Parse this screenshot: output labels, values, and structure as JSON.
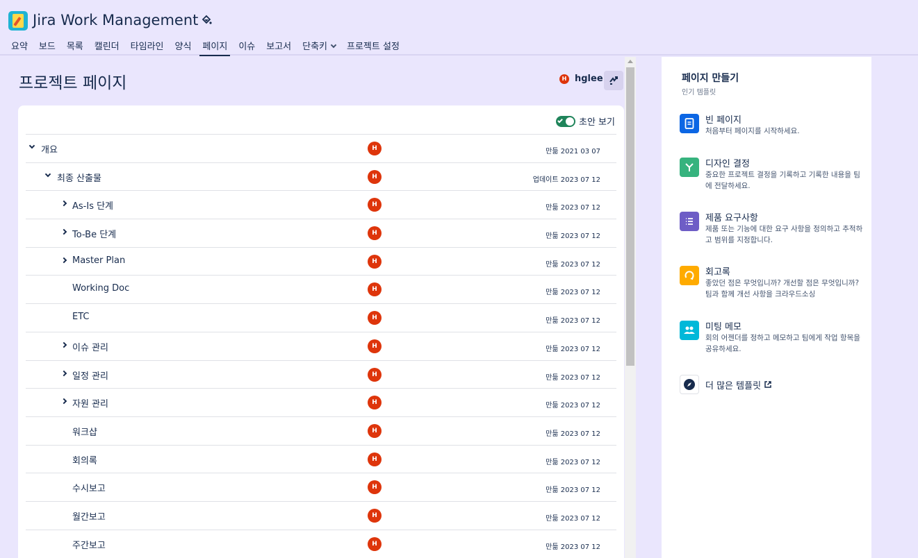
{
  "app": {
    "title": "Jira Work Management"
  },
  "nav": {
    "tabs": [
      {
        "label": "요약"
      },
      {
        "label": "보드"
      },
      {
        "label": "목록"
      },
      {
        "label": "캘린더"
      },
      {
        "label": "타임라인"
      },
      {
        "label": "양식"
      },
      {
        "label": "페이지",
        "active": true
      },
      {
        "label": "이슈"
      },
      {
        "label": "보고서"
      },
      {
        "label": "단축키"
      },
      {
        "label": "프로젝트 설정"
      }
    ]
  },
  "main": {
    "heading": "프로젝트 페이지",
    "owner": {
      "initial": "H",
      "name": "hglee"
    },
    "draft_toggle": {
      "label": "초안 보기",
      "on": true
    },
    "rows": [
      {
        "title": "개요",
        "level": 0,
        "caret": "down",
        "initial": "H",
        "date": "만듦 2021 03 07"
      },
      {
        "title": "최종 산출물",
        "level": 1,
        "caret": "down",
        "initial": "H",
        "date": "업데이트 2023 07 12"
      },
      {
        "title": "As-Is 단계",
        "level": 2,
        "caret": "right",
        "initial": "H",
        "date": "만듦 2023 07 12"
      },
      {
        "title": "To-Be 단계",
        "level": 2,
        "caret": "right",
        "initial": "H",
        "date": "만듦 2023 07 12"
      },
      {
        "title": "Master Plan",
        "level": 2,
        "caret": "right",
        "initial": "H",
        "date": "만듦 2023 07 12"
      },
      {
        "title": "Working Doc",
        "level": 2,
        "caret": "none",
        "initial": "H",
        "date": "만듦 2023 07 12"
      },
      {
        "title": "ETC",
        "level": 2,
        "caret": "none",
        "initial": "H",
        "date": "만듦 2023 07 12"
      },
      {
        "title": "이슈 관리",
        "level": 2,
        "caret": "right",
        "initial": "H",
        "date": "만듦 2023 07 12"
      },
      {
        "title": "일정 관리",
        "level": 2,
        "caret": "right",
        "initial": "H",
        "date": "만듦 2023 07 12"
      },
      {
        "title": "자원 관리",
        "level": 2,
        "caret": "right",
        "initial": "H",
        "date": "만듦 2023 07 12"
      },
      {
        "title": "워크샵",
        "level": 2,
        "caret": "none",
        "initial": "H",
        "date": "만듦 2023 07 12"
      },
      {
        "title": "회의록",
        "level": 2,
        "caret": "none",
        "initial": "H",
        "date": "만듦 2023 07 12"
      },
      {
        "title": "수시보고",
        "level": 2,
        "caret": "none",
        "initial": "H",
        "date": "만듦 2023 07 12"
      },
      {
        "title": "월간보고",
        "level": 2,
        "caret": "none",
        "initial": "H",
        "date": "만듦 2023 07 12"
      },
      {
        "title": "주간보고",
        "level": 2,
        "caret": "none",
        "initial": "H",
        "date": "만듦 2023 07 12"
      }
    ]
  },
  "panel": {
    "title": "페이지 만들기",
    "subtitle": "인기 템플릿",
    "templates": [
      {
        "name": "빈 페이지",
        "desc": "처음부터 페이지를 시작하세요.",
        "icon": "document-icon",
        "color": "#0c66e4"
      },
      {
        "name": "디자인 결정",
        "desc": "중요한 프로젝트 결정을 기록하고 기록한 내용을 팀에 전달하세요.",
        "icon": "branch-icon",
        "color": "#36b37e"
      },
      {
        "name": "제품 요구사항",
        "desc": "제품 또는 기능에 대한 요구 사항을 정의하고 추적하고 범위를 지정합니다.",
        "icon": "list-icon",
        "color": "#6e5dc6"
      },
      {
        "name": "회고록",
        "desc": "좋았던 점은 무엇입니까? 개선할 점은 무엇입니까? 팀과 함께 개선 사항을 크라우드소싱",
        "icon": "cycle-icon",
        "color": "#ffab00"
      },
      {
        "name": "미팅 메모",
        "desc": "회의 어젠더를 정하고 메모하고 팀에게 작업 항목을 공유하세요.",
        "icon": "people-icon",
        "color": "#00b8d9"
      }
    ],
    "more_label": "더 많은 템플릿"
  }
}
